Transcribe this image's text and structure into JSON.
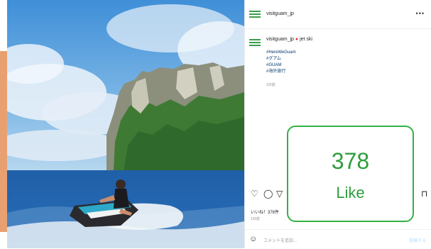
{
  "post": {
    "username": "visitguam_jp",
    "more_icon": "more-horizontal-icon",
    "caption": {
      "username": "visitguam_jp",
      "pin_icon": "location-pin-icon",
      "location": "jet ski",
      "hashtags": [
        "#HereWeGuam",
        "#グアム",
        "#GUAM",
        "#海外旅行"
      ],
      "time": "1日前"
    },
    "actions": {
      "like_icon": "heart-icon",
      "comment_icon": "comment-icon",
      "share_icon": "send-icon",
      "save_icon": "bookmark-icon"
    },
    "likes_text": "いいね！378件",
    "date_text": "1日前",
    "comment_placeholder": "コメントを追加...",
    "post_label": "投稿する",
    "emoji_icon": "smile-icon"
  },
  "callout": {
    "count": "378",
    "label": "Like",
    "accent": "#34b045"
  }
}
